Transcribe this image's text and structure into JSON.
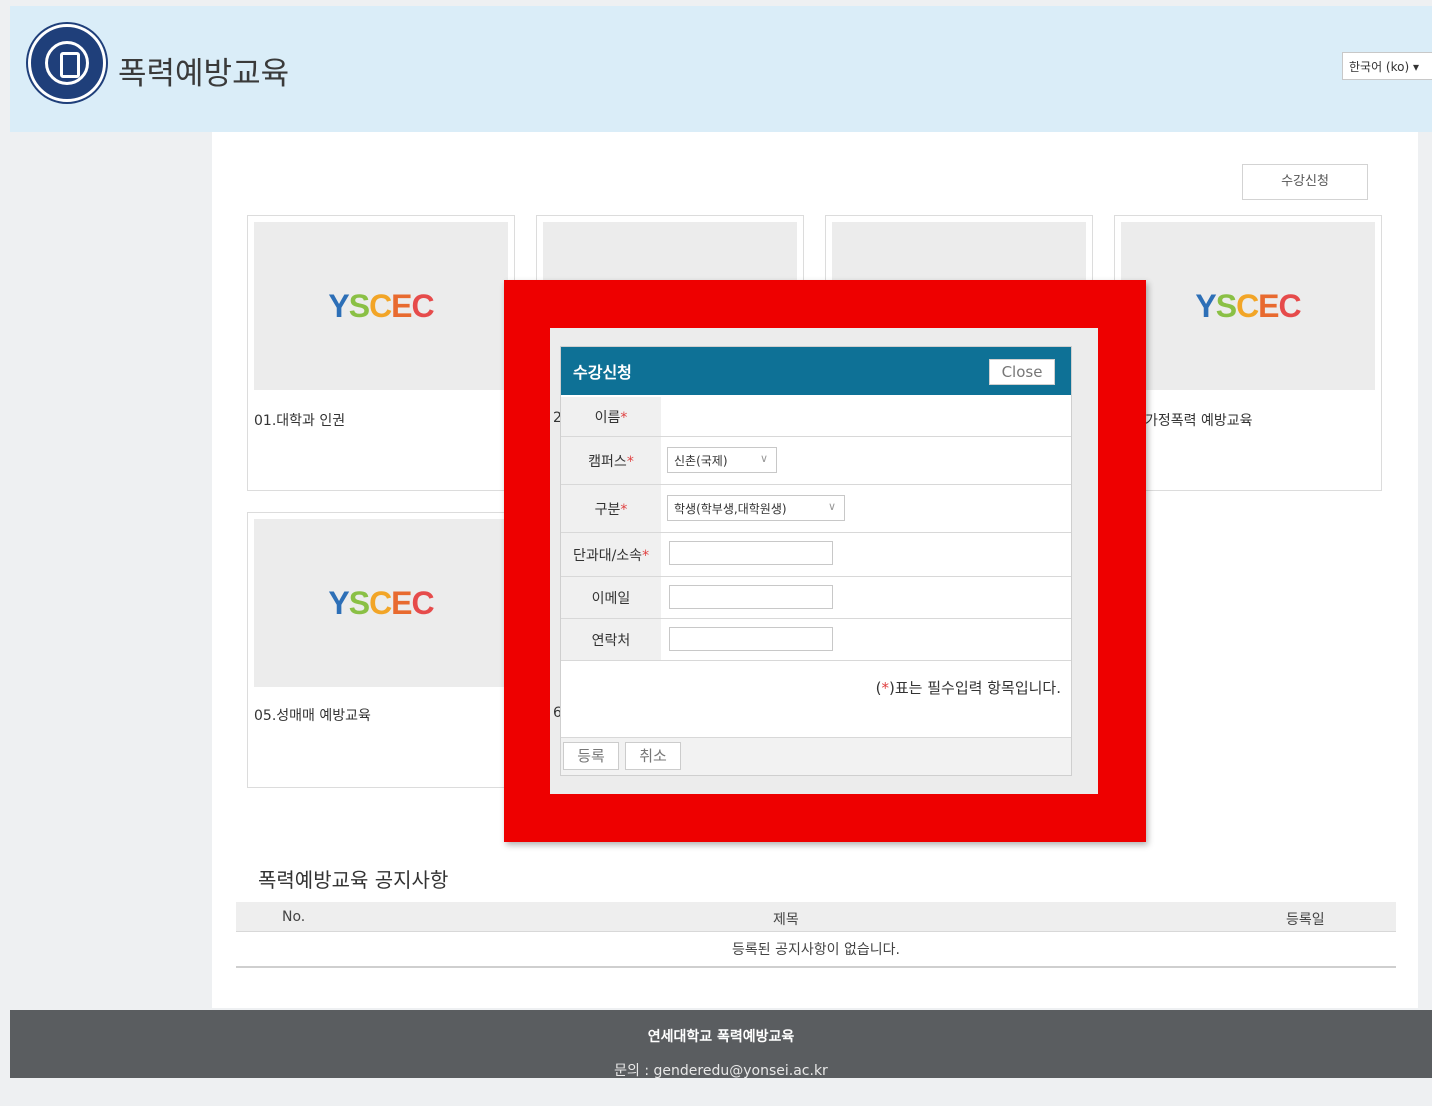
{
  "header": {
    "site_title": "폭력예방교육",
    "language": "한국어 (ko)"
  },
  "main": {
    "enroll_button": "수강신청",
    "logo_letters": [
      "Y",
      "S",
      "C",
      "E",
      "C"
    ],
    "courses": [
      {
        "title": "01.대학과 인권"
      },
      {
        "title": "가정폭력 예방교육"
      },
      {
        "title": "05.성매매 예방교육"
      }
    ],
    "partial_labels": [
      "2",
      "6"
    ]
  },
  "notice": {
    "title": "폭력예방교육 공지사항",
    "columns": [
      "No.",
      "제목",
      "등록일"
    ],
    "empty_text": "등록된 공지사항이 없습니다."
  },
  "footer": {
    "org": "연세대학교 폭력예방교육",
    "contact": "문의 : genderedu@yonsei.ac.kr"
  },
  "modal": {
    "title": "수강신청",
    "close": "Close",
    "required_mark": "*",
    "fields": {
      "name_label": "이름",
      "campus_label": "캠퍼스",
      "campus_value": "신촌(국제)",
      "category_label": "구분",
      "category_value": "학생(학부생,대학원생)",
      "department_label": "단과대/소속",
      "email_label": "이메일",
      "phone_label": "연락처"
    },
    "required_note_open": "(",
    "required_note_close": ")표는 필수입력 항목입니다.",
    "register_button": "등록",
    "cancel_button": "취소"
  },
  "colors": {
    "header_bg": "#daedf8",
    "modal_bar": "#0e7196",
    "highlight": "#ee0000",
    "footer_bg": "#5a5d60"
  }
}
